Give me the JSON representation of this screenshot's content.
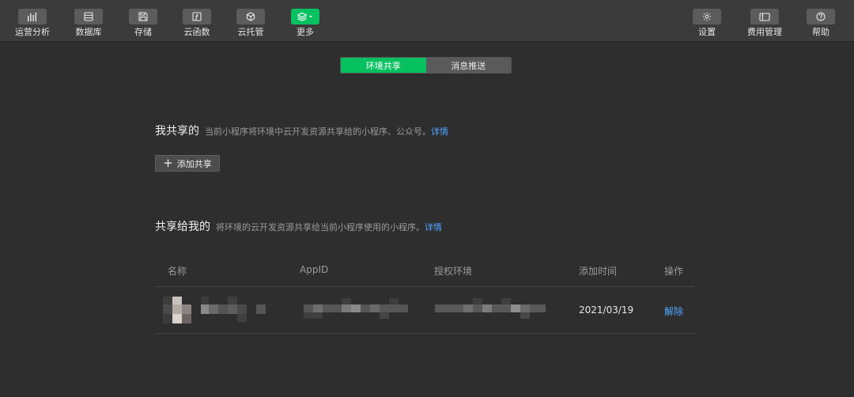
{
  "toolbar": {
    "left_items": [
      {
        "label": "运营分析",
        "icon": "bar-chart-icon"
      },
      {
        "label": "数据库",
        "icon": "database-icon"
      },
      {
        "label": "存储",
        "icon": "storage-icon"
      },
      {
        "label": "云函数",
        "icon": "cloud-function-icon"
      },
      {
        "label": "云托管",
        "icon": "cube-icon"
      },
      {
        "label": "更多",
        "icon": "layers-icon"
      }
    ],
    "right_items": [
      {
        "label": "设置",
        "icon": "gear-icon"
      },
      {
        "label": "费用管理",
        "icon": "billing-icon"
      },
      {
        "label": "帮助",
        "icon": "help-icon"
      }
    ]
  },
  "tabs": [
    {
      "label": "环境共享",
      "active": true
    },
    {
      "label": "消息推送",
      "active": false
    }
  ],
  "my_shared": {
    "title": "我共享的",
    "description": "当前小程序将环境中云开发资源共享给的小程序、公众号。",
    "link": "详情",
    "add_button": "添加共享"
  },
  "shared_to_me": {
    "title": "共享给我的",
    "description": "将环境的云开发资源共享给当前小程序使用的小程序。",
    "link": "详情"
  },
  "table": {
    "columns": [
      "名称",
      "AppID",
      "授权环境",
      "添加时间",
      "操作"
    ],
    "rows": [
      {
        "date": "2021/03/19",
        "action": "解除"
      }
    ]
  },
  "colors": {
    "accent": "#07c160",
    "link": "#4fa6ff",
    "background": "#2e2e2e",
    "toolbar": "#3b3b3b"
  }
}
